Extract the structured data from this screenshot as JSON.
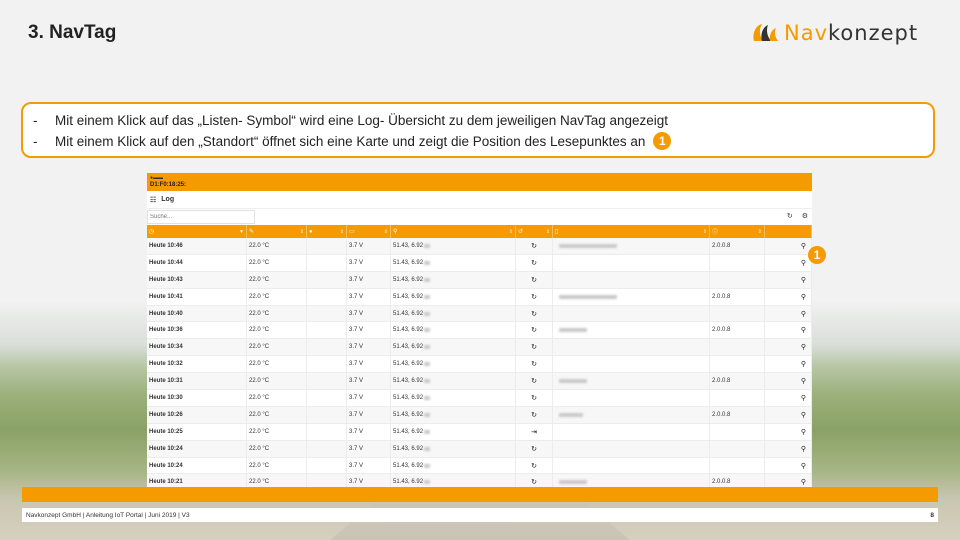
{
  "slide": {
    "title": "3. NavTag",
    "logo": {
      "part1": "Nav",
      "part2": "konzept"
    },
    "notes": [
      {
        "dash": "-",
        "text": "Mit einem Klick auf das „Listen- Symbol“ wird eine Log- Übersicht zu dem jeweiligen NavTag angezeigt"
      },
      {
        "dash": "-",
        "text": "Mit einem Klick auf den „Standort“ öffnet sich eine Karte und zeigt die Position des Lesepunktes an",
        "badge": "1"
      }
    ],
    "row_badge": "1",
    "footer": "Navkonzept GmbH  |  Anleitung IoT Portal  |  Juni 2019  |  V3",
    "page_number": "8"
  },
  "app": {
    "device_id": "D1:F0:18:25:",
    "log_title": "Log",
    "search_placeholder": "Suche...",
    "columns": [
      "",
      "",
      "",
      "",
      "",
      "",
      "",
      "",
      ""
    ],
    "rows": [
      {
        "time": "Heute 10:46",
        "temp": "22.0 °C",
        "batt": "3.7 V",
        "pos": "51.43, 6.92",
        "sync": "↻",
        "info": true,
        "fw": "2.0.0.8"
      },
      {
        "time": "Heute 10:44",
        "temp": "22.0 °C",
        "batt": "3.7 V",
        "pos": "51.43, 6.92",
        "sync": "↻",
        "info": false,
        "fw": ""
      },
      {
        "time": "Heute 10:43",
        "temp": "22.0 °C",
        "batt": "3.7 V",
        "pos": "51.43, 6.92",
        "sync": "↻",
        "info": false,
        "fw": ""
      },
      {
        "time": "Heute 10:41",
        "temp": "22.0 °C",
        "batt": "3.7 V",
        "pos": "51.43, 6.92",
        "sync": "↻",
        "info": true,
        "fw": "2.0.0.8"
      },
      {
        "time": "Heute 10:40",
        "temp": "22.0 °C",
        "batt": "3.7 V",
        "pos": "51.43, 6.92",
        "sync": "↻",
        "info": false,
        "fw": ""
      },
      {
        "time": "Heute 10:36",
        "temp": "22.0 °C",
        "batt": "3.7 V",
        "pos": "51.43, 6.92",
        "sync": "↻",
        "info": true,
        "fw": "2.0.0.8"
      },
      {
        "time": "Heute 10:34",
        "temp": "22.0 °C",
        "batt": "3.7 V",
        "pos": "51.43, 6.92",
        "sync": "↻",
        "info": false,
        "fw": ""
      },
      {
        "time": "Heute 10:32",
        "temp": "22.0 °C",
        "batt": "3.7 V",
        "pos": "51.43, 6.92",
        "sync": "↻",
        "info": false,
        "fw": ""
      },
      {
        "time": "Heute 10:31",
        "temp": "22.0 °C",
        "batt": "3.7 V",
        "pos": "51.43, 6.92",
        "sync": "↻",
        "info": true,
        "fw": "2.0.0.8"
      },
      {
        "time": "Heute 10:30",
        "temp": "22.0 °C",
        "batt": "3.7 V",
        "pos": "51.43, 6.92",
        "sync": "↻",
        "info": false,
        "fw": ""
      },
      {
        "time": "Heute 10:26",
        "temp": "22.0 °C",
        "batt": "3.7 V",
        "pos": "51.43, 6.92",
        "sync": "↻",
        "info": true,
        "fw": "2.0.0.8"
      },
      {
        "time": "Heute 10:25",
        "temp": "22.0 °C",
        "batt": "3.7 V",
        "pos": "51.43, 6.92",
        "sync": "⇥",
        "info": false,
        "fw": ""
      },
      {
        "time": "Heute 10:24",
        "temp": "22.0 °C",
        "batt": "3.7 V",
        "pos": "51.43, 6.92",
        "sync": "↻",
        "info": false,
        "fw": ""
      },
      {
        "time": "Heute 10:24",
        "temp": "22.0 °C",
        "batt": "3.7 V",
        "pos": "51.43, 6.92",
        "sync": "↻",
        "info": false,
        "fw": ""
      },
      {
        "time": "Heute 10:21",
        "temp": "22.0 °C",
        "batt": "3.7 V",
        "pos": "51.43, 6.92",
        "sync": "↻",
        "info": true,
        "fw": "2.0.0.8"
      }
    ]
  },
  "colors": {
    "accent": "#f59a00"
  }
}
